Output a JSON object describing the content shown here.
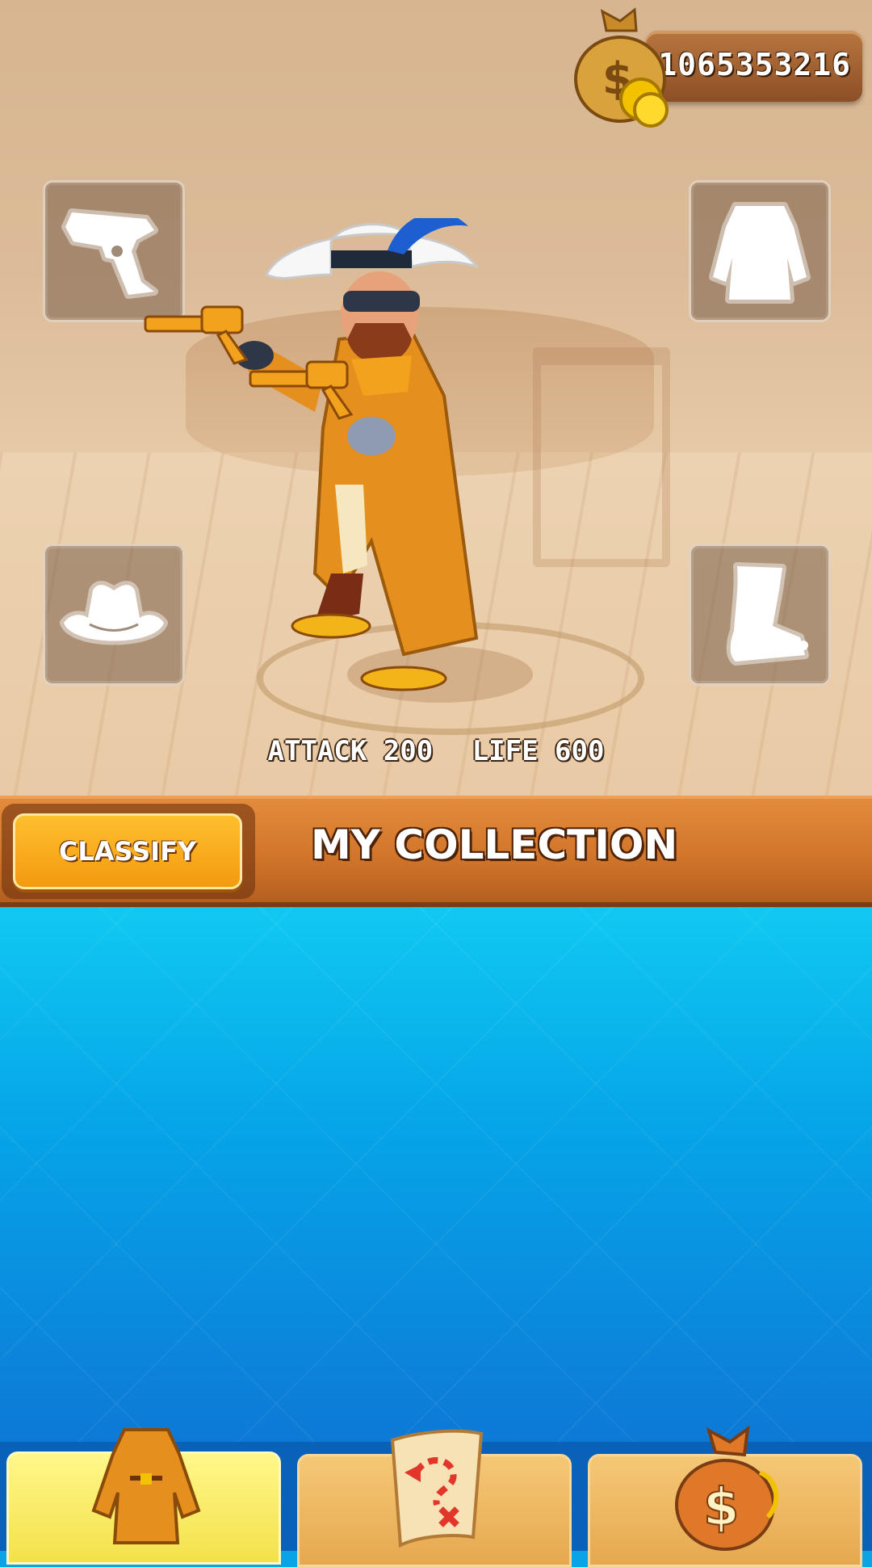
{
  "currency": {
    "coins": "1065353216",
    "icon": "money-bag-icon"
  },
  "slots": [
    {
      "name": "gun",
      "icon": "revolver-icon"
    },
    {
      "name": "coat",
      "icon": "coat-icon"
    },
    {
      "name": "hat",
      "icon": "cowboy-hat-icon"
    },
    {
      "name": "boot",
      "icon": "boot-icon"
    }
  ],
  "stats": {
    "attack": "ATTACK 200",
    "life": "LIFE 600"
  },
  "banner": {
    "classify_label": "CLASSIFY",
    "title": "MY COLLECTION"
  },
  "tabs": [
    {
      "name": "outfit",
      "icon": "coat-icon",
      "selected": true
    },
    {
      "name": "map",
      "icon": "treasure-map-icon",
      "selected": false
    },
    {
      "name": "shop",
      "icon": "money-bag-icon",
      "selected": false
    }
  ],
  "colors": {
    "banner": "#d1762b",
    "classify": "#f39a0f",
    "collection_bg": "#06a5e8",
    "active_tab": "#f4e14a"
  }
}
